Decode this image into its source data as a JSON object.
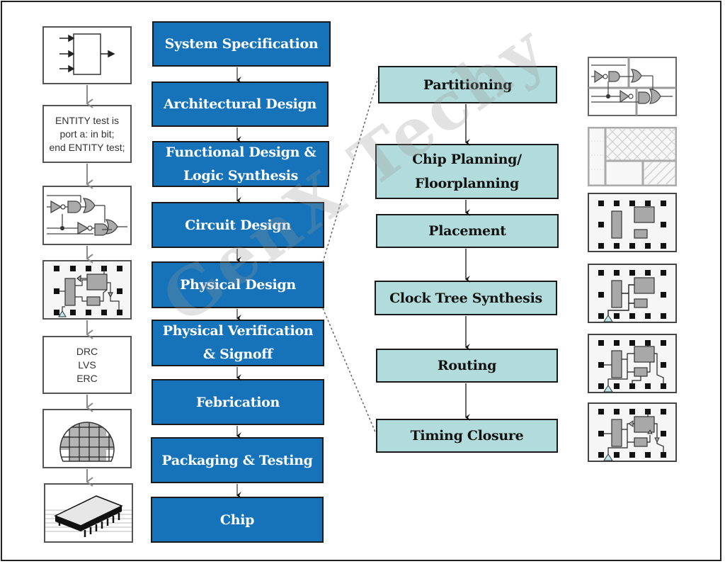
{
  "diagram": {
    "watermark": "GenX Techy",
    "main_flow": [
      {
        "label": "System Specification"
      },
      {
        "label": "Architectural Design"
      },
      {
        "label_line1": "Functional Design &",
        "label_line2": "Logic Synthesis"
      },
      {
        "label": "Circuit Design"
      },
      {
        "label": "Physical Design"
      },
      {
        "label_line1": "Physical Verification",
        "label_line2": "& Signoff"
      },
      {
        "label": "Febrication"
      },
      {
        "label": "Packaging & Testing"
      },
      {
        "label": "Chip"
      }
    ],
    "physical_design_flow": [
      {
        "label": "Partitioning"
      },
      {
        "label_line1": "Chip Planning/",
        "label_line2": "Floorplanning"
      },
      {
        "label": "Placement"
      },
      {
        "label": "Clock Tree Synthesis"
      },
      {
        "label": "Routing"
      },
      {
        "label": "Timing Closure"
      }
    ],
    "left_illustrations": {
      "vhdl_code": {
        "line1": "ENTITY test is",
        "line2": "port a: in bit;",
        "line3": "end ENTITY test;"
      },
      "verification_checks": {
        "line1": "DRC",
        "line2": "LVS",
        "line3": "ERC"
      }
    },
    "colors": {
      "main_box_fill": "#1673b9",
      "sub_box_fill": "#b2dcdc",
      "cell_fill": "#a8a8a8",
      "clock_triangle": "#bfe8ea"
    }
  }
}
